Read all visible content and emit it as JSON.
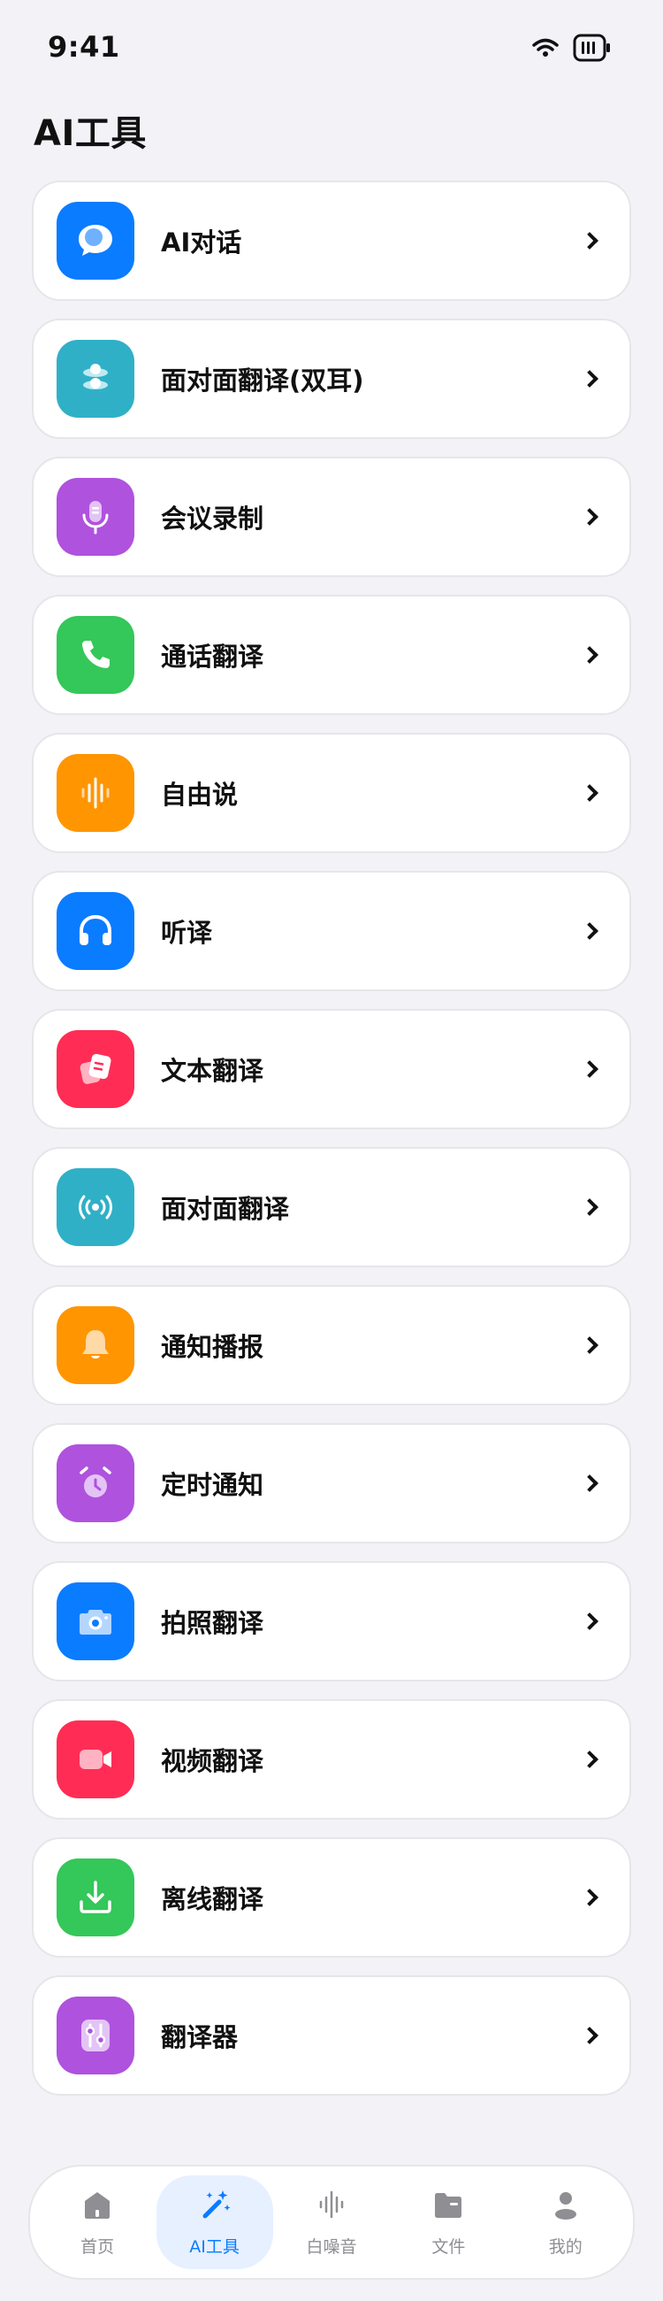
{
  "status": {
    "time": "9:41"
  },
  "header": {
    "title": "AI工具"
  },
  "tools": [
    {
      "label": "AI对话",
      "icon": "chat-bubble-icon",
      "color": "#0a7cff"
    },
    {
      "label": "面对面翻译(双耳)",
      "icon": "face-to-face-icon",
      "color": "#30b0c7"
    },
    {
      "label": "会议录制",
      "icon": "microphone-icon",
      "color": "#af52de"
    },
    {
      "label": "通话翻译",
      "icon": "phone-icon",
      "color": "#34c759"
    },
    {
      "label": "自由说",
      "icon": "waveform-icon",
      "color": "#ff9500"
    },
    {
      "label": "听译",
      "icon": "headphones-icon",
      "color": "#0a7cff"
    },
    {
      "label": "文本翻译",
      "icon": "text-cards-icon",
      "color": "#ff2d55"
    },
    {
      "label": "面对面翻译",
      "icon": "broadcast-icon",
      "color": "#30b0c7"
    },
    {
      "label": "通知播报",
      "icon": "bell-icon",
      "color": "#ff9500"
    },
    {
      "label": "定时通知",
      "icon": "alarm-clock-icon",
      "color": "#af52de"
    },
    {
      "label": "拍照翻译",
      "icon": "camera-icon",
      "color": "#0a7cff"
    },
    {
      "label": "视频翻译",
      "icon": "video-camera-icon",
      "color": "#ff2d55"
    },
    {
      "label": "离线翻译",
      "icon": "download-icon",
      "color": "#34c759"
    },
    {
      "label": "翻译器",
      "icon": "sliders-icon",
      "color": "#af52de"
    }
  ],
  "tabbar": {
    "items": [
      {
        "label": "首页",
        "icon": "home-icon",
        "active": false
      },
      {
        "label": "AI工具",
        "icon": "magic-wand-icon",
        "active": true
      },
      {
        "label": "白噪音",
        "icon": "sound-wave-icon",
        "active": false
      },
      {
        "label": "文件",
        "icon": "folder-icon",
        "active": false
      },
      {
        "label": "我的",
        "icon": "person-icon",
        "active": false
      }
    ],
    "active_color": "#0a7cff",
    "inactive_color": "#8e8e93"
  }
}
